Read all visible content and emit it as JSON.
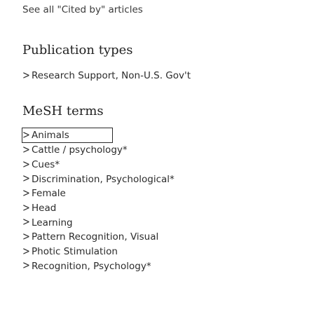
{
  "cited_by_link": "See all \"Cited by\" articles",
  "publication_types": {
    "heading": "Publication types",
    "items": [
      {
        "label": "Research Support, Non-U.S. Gov't"
      }
    ]
  },
  "mesh_terms": {
    "heading": "MeSH terms",
    "items": [
      {
        "label": "Animals"
      },
      {
        "label": "Cattle / psychology*"
      },
      {
        "label": "Cues*"
      },
      {
        "label": "Discrimination, Psychological*"
      },
      {
        "label": "Female"
      },
      {
        "label": "Head"
      },
      {
        "label": "Learning"
      },
      {
        "label": "Pattern Recognition, Visual"
      },
      {
        "label": "Photic Stimulation"
      },
      {
        "label": "Recognition, Psychology*"
      }
    ]
  },
  "icons": {
    "expand": "chevron-right-icon"
  }
}
